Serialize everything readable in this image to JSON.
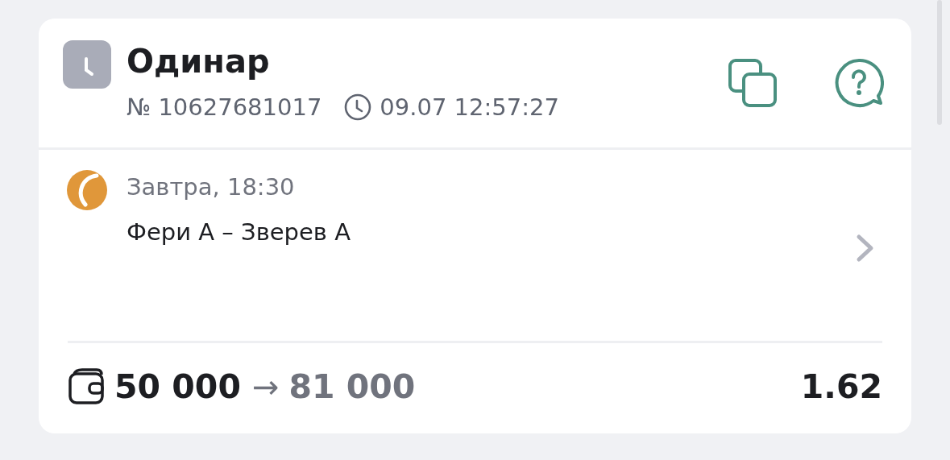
{
  "bet": {
    "type": "Одинар",
    "number": "№ 10627681017",
    "time": "09.07 12:57:27"
  },
  "events": [
    {
      "kind": "tennis",
      "start": "Завтра, 18:30",
      "match": "Фери А – Зверев А"
    }
  ],
  "footer": {
    "stake": "50 000",
    "arrow": "→",
    "payout": "81 000",
    "odds": "1.62"
  }
}
